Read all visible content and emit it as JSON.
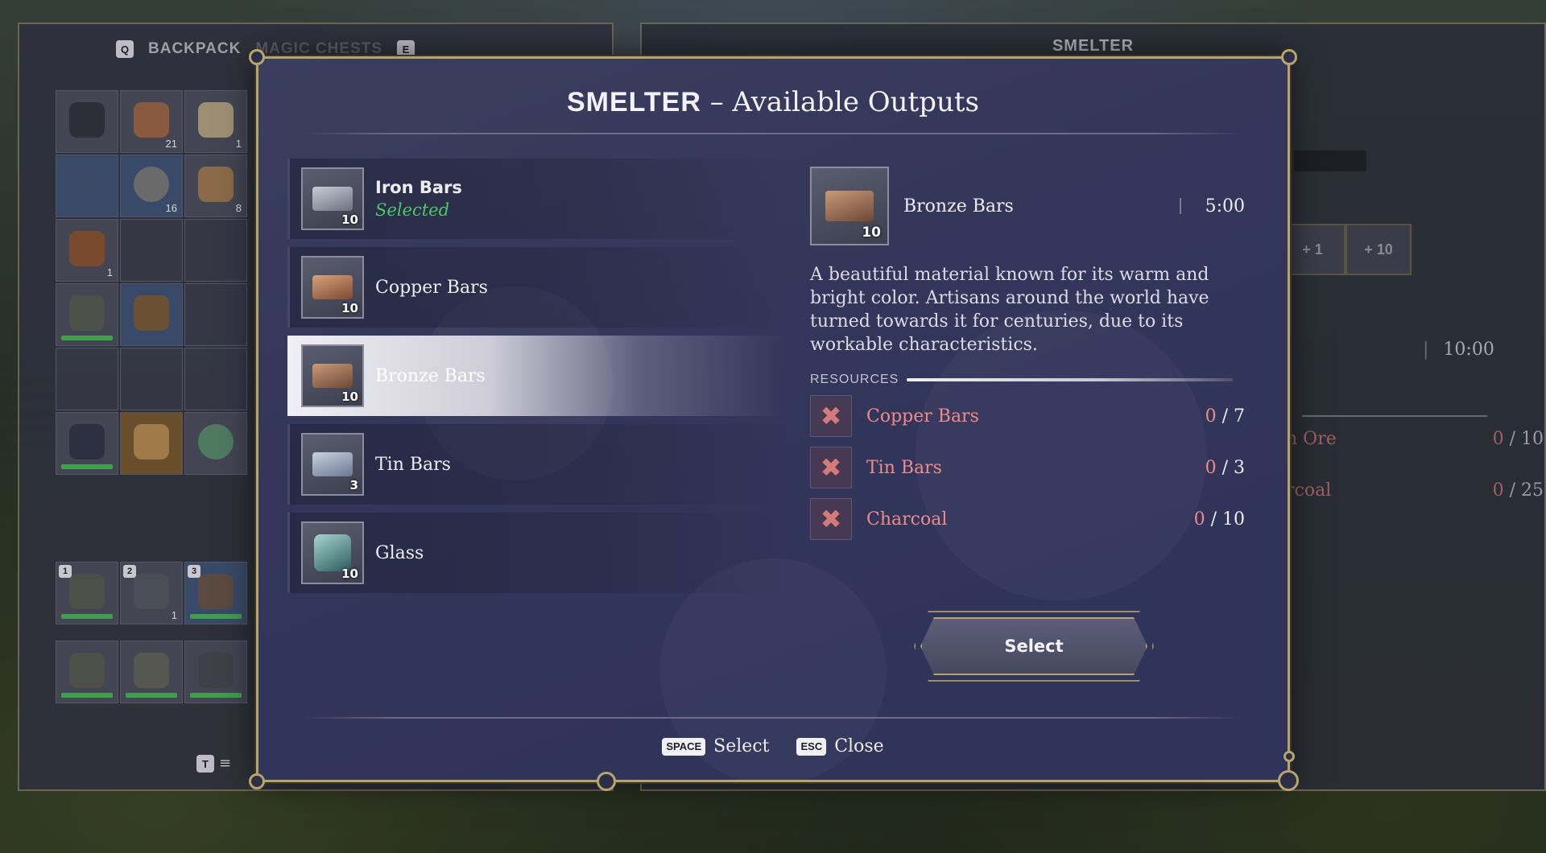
{
  "colors": {
    "accent_gold": "#b8a468",
    "selected_green": "#4bc869",
    "missing_red": "#ee8a8a",
    "modal_bg": "#33365a"
  },
  "left_panel": {
    "tab_key_q": "Q",
    "tab_backpack": "BACKPACK",
    "tab_magic_chests": "MAGIC CHESTS",
    "tab_key_e": "E",
    "grid_counts": [
      "",
      "21",
      "1",
      "",
      "16",
      "8",
      "1"
    ],
    "hotbar_keys": [
      "1",
      "2",
      "3"
    ],
    "hotbar_counts": [
      "",
      "1",
      ""
    ],
    "sort_key": "T"
  },
  "right_panel": {
    "title": "SMELTER",
    "step_labels": [
      "+ 1",
      "+ 10"
    ],
    "time": "10:00",
    "resources": [
      {
        "name": "n Ore",
        "have": "0",
        "need": "10"
      },
      {
        "name": "rcoal",
        "have": "0",
        "need": "25"
      }
    ]
  },
  "modal": {
    "title_strong": "SMELTER",
    "title_dash": "–",
    "title_rest": "Available Outputs",
    "items": [
      {
        "name": "Iron Bars",
        "qty": "10",
        "status": "Selected",
        "icon": "iron-bars-icon"
      },
      {
        "name": "Copper Bars",
        "qty": "10",
        "status": "",
        "icon": "copper-bars-icon"
      },
      {
        "name": "Bronze Bars",
        "qty": "10",
        "status": "",
        "icon": "bronze-bars-icon"
      },
      {
        "name": "Tin Bars",
        "qty": "3",
        "status": "",
        "icon": "tin-bars-icon"
      },
      {
        "name": "Glass",
        "qty": "10",
        "status": "",
        "icon": "glass-icon"
      }
    ],
    "detail": {
      "name": "Bronze Bars",
      "qty": "10",
      "time": "5:00",
      "description": "A beautiful material known for its warm and bright color. Artisans around the world have turned towards it for centuries, due to its workable characteristics.",
      "resources_label": "RESOURCES",
      "resources": [
        {
          "name": "Copper Bars",
          "have": "0",
          "need": "7"
        },
        {
          "name": "Tin Bars",
          "have": "0",
          "need": "3"
        },
        {
          "name": "Charcoal",
          "have": "0",
          "need": "10"
        }
      ]
    },
    "select_button": "Select",
    "footer": {
      "space_key": "SPACE",
      "space_label": "Select",
      "esc_key": "ESC",
      "esc_label": "Close"
    }
  }
}
